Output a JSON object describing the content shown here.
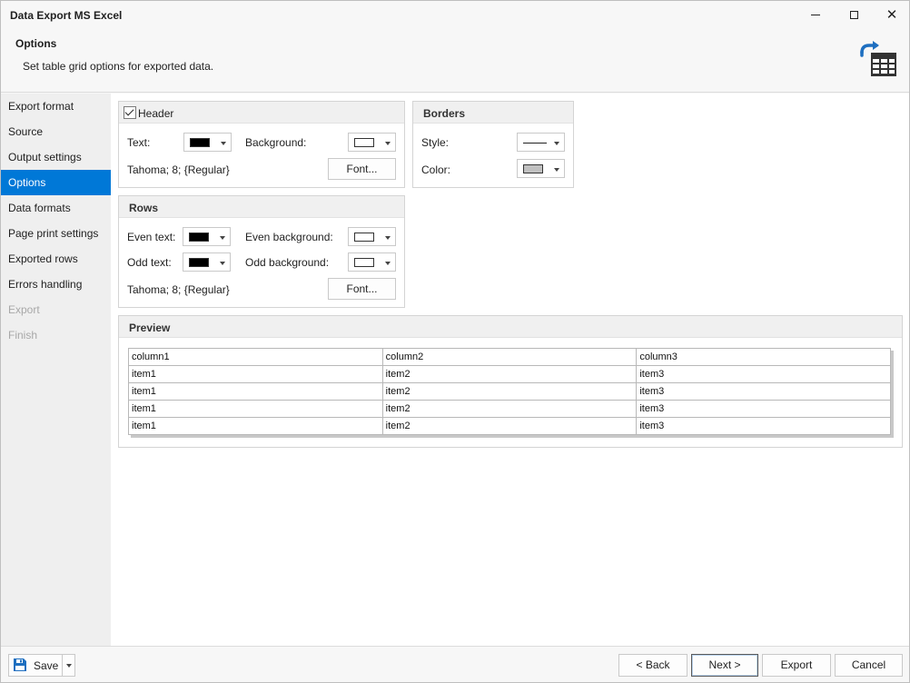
{
  "window": {
    "title": "Data Export MS Excel"
  },
  "header": {
    "title": "Options",
    "description": "Set table grid options for exported data."
  },
  "sidebar": {
    "items": [
      {
        "label": "Export format",
        "state": "normal"
      },
      {
        "label": "Source",
        "state": "normal"
      },
      {
        "label": "Output settings",
        "state": "normal"
      },
      {
        "label": "Options",
        "state": "active"
      },
      {
        "label": "Data formats",
        "state": "normal"
      },
      {
        "label": "Page print settings",
        "state": "normal"
      },
      {
        "label": "Exported rows",
        "state": "normal"
      },
      {
        "label": "Errors handling",
        "state": "normal"
      },
      {
        "label": "Export",
        "state": "disabled"
      },
      {
        "label": "Finish",
        "state": "disabled"
      }
    ]
  },
  "header_group": {
    "checkbox_label": "Header",
    "checked": true,
    "text_label": "Text:",
    "text_color": "#000000",
    "background_label": "Background:",
    "background_color": "#ffffff",
    "font_desc": "Tahoma; 8; {Regular}",
    "font_button": "Font..."
  },
  "borders_group": {
    "title": "Borders",
    "style_label": "Style:",
    "color_label": "Color:",
    "color_value": "#c0c0c0"
  },
  "rows_group": {
    "title": "Rows",
    "even_text_label": "Even text:",
    "even_text_color": "#000000",
    "even_bg_label": "Even background:",
    "even_bg_color": "#ffffff",
    "odd_text_label": "Odd text:",
    "odd_text_color": "#000000",
    "odd_bg_label": "Odd background:",
    "odd_bg_color": "#ffffff",
    "font_desc": "Tahoma; 8; {Regular}",
    "font_button": "Font..."
  },
  "preview": {
    "title": "Preview",
    "columns": [
      "column1",
      "column2",
      "column3"
    ],
    "rows": [
      [
        "item1",
        "item2",
        "item3"
      ],
      [
        "item1",
        "item2",
        "item3"
      ],
      [
        "item1",
        "item2",
        "item3"
      ],
      [
        "item1",
        "item2",
        "item3"
      ]
    ]
  },
  "footer": {
    "save_label": "Save",
    "back_label": "< Back",
    "next_label": "Next >",
    "export_label": "Export",
    "cancel_label": "Cancel"
  },
  "colors": {
    "accent": "#0078d7",
    "icon_blue": "#1e6fc0",
    "icon_dark": "#333333"
  }
}
